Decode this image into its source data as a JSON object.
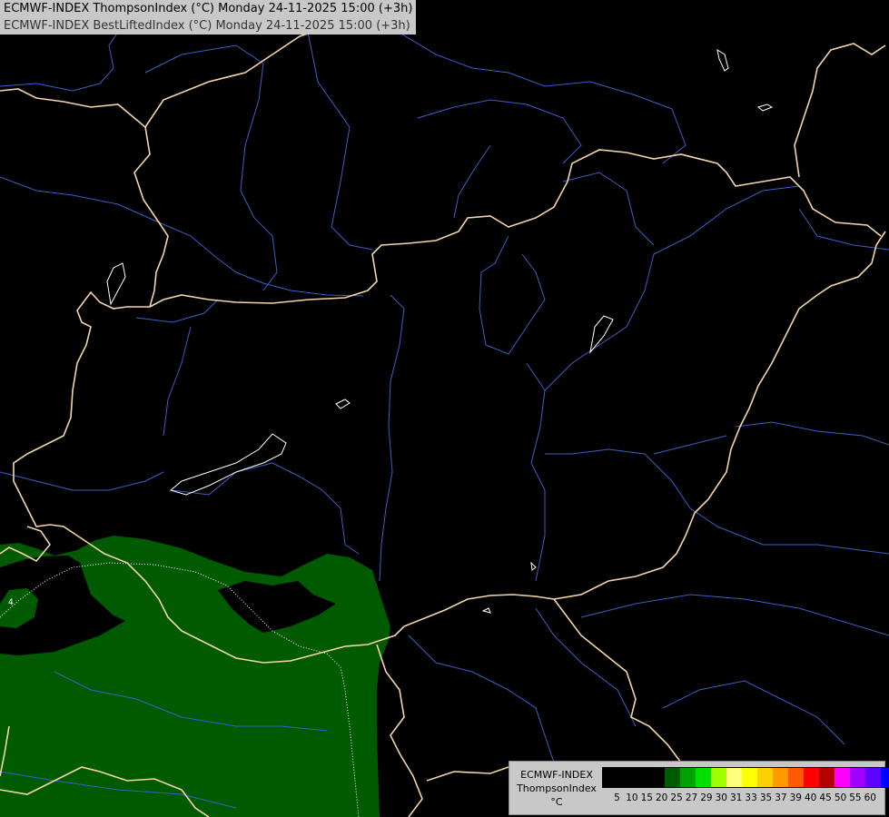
{
  "header": {
    "line1": "ECMWF-INDEX ThompsonIndex (°C) Monday 24-11-2025 15:00 (+3h)",
    "line2": "ECMWF-INDEX BestLiftedIndex (°C) Monday 24-11-2025 15:00 (+3h)"
  },
  "map": {
    "background_color": "#000000",
    "border_color": "#f5d6a8",
    "river_color": "#3a5fc8",
    "lake_color": "#ffffff",
    "shade_color": "#005a00",
    "contour_label": "4"
  },
  "legend": {
    "source": "ECMWF-INDEX",
    "parameter": "ThompsonIndex",
    "unit": "°C",
    "levels": [
      "5",
      "10",
      "15",
      "20",
      "25",
      "27",
      "29",
      "30",
      "31",
      "33",
      "35",
      "37",
      "39",
      "40",
      "45",
      "50",
      "55",
      "60"
    ],
    "colors": [
      "#000000",
      "#000000",
      "#000000",
      "#000000",
      "#005a00",
      "#00a000",
      "#00e000",
      "#a0ff00",
      "#ffff80",
      "#ffff00",
      "#ffd000",
      "#ff9a00",
      "#ff5a00",
      "#ff0000",
      "#b40000",
      "#ff00ff",
      "#a000ff",
      "#6000ff",
      "#0000ff"
    ]
  }
}
